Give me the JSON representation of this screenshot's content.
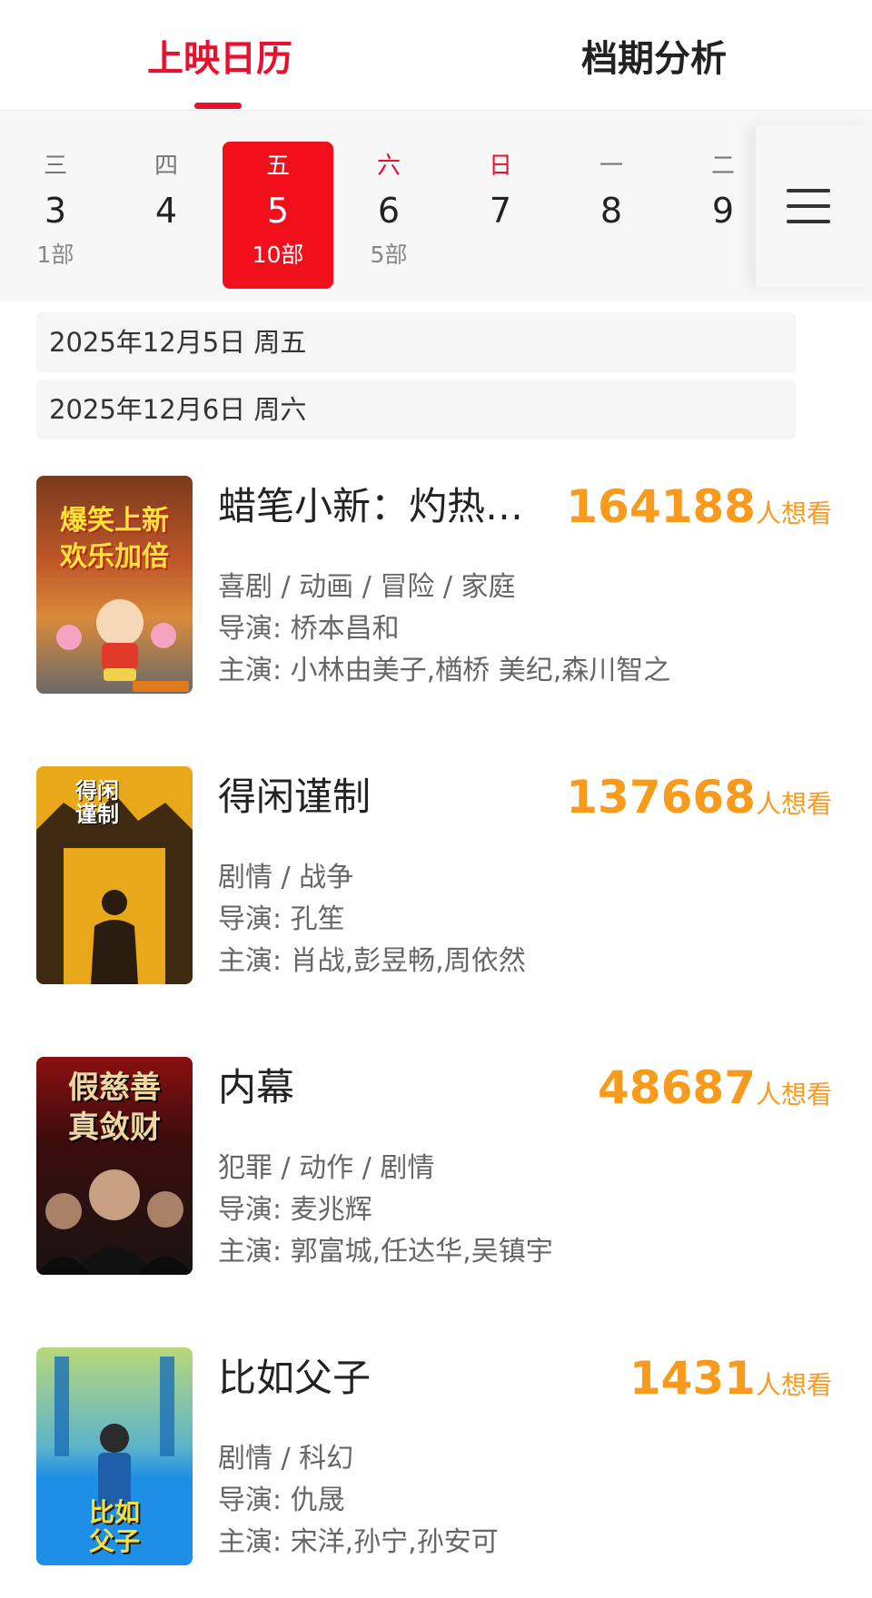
{
  "tabs": [
    {
      "label": "上映日历"
    },
    {
      "label": "档期分析"
    }
  ],
  "days": [
    {
      "weekday": "三",
      "date": "3",
      "count": "1部"
    },
    {
      "weekday": "四",
      "date": "4",
      "count": ""
    },
    {
      "weekday": "五",
      "date": "5",
      "count": "10部"
    },
    {
      "weekday": "六",
      "date": "6",
      "count": "5部"
    },
    {
      "weekday": "日",
      "date": "7",
      "count": ""
    },
    {
      "weekday": "一",
      "date": "8",
      "count": ""
    },
    {
      "weekday": "二",
      "date": "9",
      "count": ""
    }
  ],
  "date_headers": [
    {
      "text": "2025年12月5日  周五"
    },
    {
      "text": "2025年12月6日  周六"
    }
  ],
  "want_unit": "人想看",
  "movies": [
    {
      "title": "蜡笔小新：灼热…",
      "want": "164188",
      "genres": "喜剧 / 动画 / 冒险 / 家庭",
      "director": "导演: 桥本昌和",
      "cast": "主演: 小林由美子,楢桥 美纪,森川智之",
      "poster_text": "爆笑上新\n欢乐加倍"
    },
    {
      "title": "得闲谨制",
      "want": "137668",
      "genres": "剧情 / 战争",
      "director": "导演: 孔笙",
      "cast": "主演: 肖战,彭昱畅,周依然",
      "poster_text": "得闲谨制"
    },
    {
      "title": "内幕",
      "want": "48687",
      "genres": "犯罪 / 动作 / 剧情",
      "director": "导演: 麦兆辉",
      "cast": "主演: 郭富城,任达华,吴镇宇",
      "poster_text": "假慈善\n真敛财"
    },
    {
      "title": "比如父子",
      "want": "1431",
      "genres": "剧情 / 科幻",
      "director": "导演: 仇晟",
      "cast": "主演: 宋洋,孙宁,孙安可",
      "poster_text": "比如父子"
    }
  ],
  "colors": {
    "accent": "#e8112d",
    "want": "#f89a1c"
  }
}
